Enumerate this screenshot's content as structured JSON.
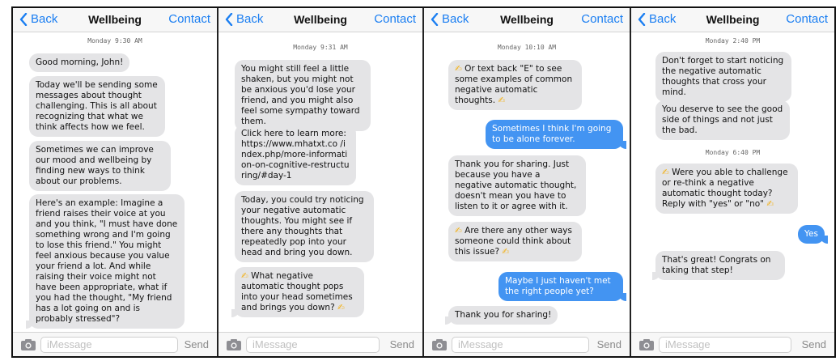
{
  "colors": {
    "accent": "#1a7ef2",
    "incoming_bubble": "#e4e4e6",
    "outgoing_bubble": "#4394f2"
  },
  "panels": [
    {
      "back": "Back",
      "title": "Wellbeing",
      "contact": "Contact",
      "compose_placeholder": "iMessage",
      "send": "Send",
      "times": [
        "Monday 9:30 AM"
      ],
      "messages": [
        {
          "from": "in",
          "text": "Good morning, John!"
        },
        {
          "from": "in",
          "text": "Today we'll be sending some messages about thought challenging. This is all about recognizing that what we think affects how we feel."
        },
        {
          "from": "in",
          "text": "Sometimes we can improve our mood and wellbeing by finding new ways to think about our problems."
        },
        {
          "from": "in",
          "text": "Here's an example: Imagine a friend raises their voice at you and you think, \"I must have done something wrong and I'm going to lose this friend.\" You might feel anxious because you value your friend a lot. And while raising their voice might not have been appropriate, what if you had the thought, \"My friend has a lot going on and is probably stressed\"?"
        }
      ]
    },
    {
      "back": "Back",
      "title": "Wellbeing",
      "contact": "Contact",
      "compose_placeholder": "iMessage",
      "send": "Send",
      "times": [
        "Monday 9:31 AM"
      ],
      "messages": [
        {
          "from": "in",
          "text": "You might still feel a little shaken, but you might not be anxious you'd lose your friend, and you might also feel some sympathy toward them."
        },
        {
          "from": "in",
          "text": "Click here to learn more: https://www.mhatxt.co /index.php/more-information-on-cognitive-restructuring/#day-1"
        },
        {
          "from": "in",
          "text": "Today, you could try noticing your negative automatic thoughts. You might see if there any thoughts that repeatedly pop into your head and bring you down."
        },
        {
          "from": "in",
          "text": "What negative automatic thought pops into your head sometimes and brings you down?"
        }
      ]
    },
    {
      "back": "Back",
      "title": "Wellbeing",
      "contact": "Contact",
      "compose_placeholder": "iMessage",
      "send": "Send",
      "times": [
        "Monday 10:10 AM"
      ],
      "messages": [
        {
          "from": "in",
          "text": "Or text back \"E\" to see some examples of common negative automatic thoughts."
        },
        {
          "from": "out",
          "text": "Sometimes I think I'm going to be alone forever."
        },
        {
          "from": "in",
          "text": "Thank you for sharing. Just because you have a negative automatic thought, doesn't mean you have to listen to it or agree with it."
        },
        {
          "from": "in",
          "text": "Are there any other ways someone could think about this issue?"
        },
        {
          "from": "out",
          "text": "Maybe I just haven't met the right people yet?"
        },
        {
          "from": "in",
          "text": "Thank you for sharing!"
        }
      ]
    },
    {
      "back": "Back",
      "title": "Wellbeing",
      "contact": "Contact",
      "compose_placeholder": "iMessage",
      "send": "Send",
      "times": [
        "Monday 2:40 PM",
        "Monday 6:40 PM"
      ],
      "messages": [
        {
          "from": "in",
          "text": "Don't forget to start noticing the negative automatic thoughts that cross your mind."
        },
        {
          "from": "in",
          "text": "You deserve to see the good side of things and not just the bad."
        },
        {
          "from": "in",
          "text": "Were you able to challenge or re-think a negative automatic thought today? Reply with \"yes\" or \"no\""
        },
        {
          "from": "out",
          "text": "Yes"
        },
        {
          "from": "in",
          "text": "That's great! Congrats on taking that step!"
        }
      ]
    }
  ]
}
